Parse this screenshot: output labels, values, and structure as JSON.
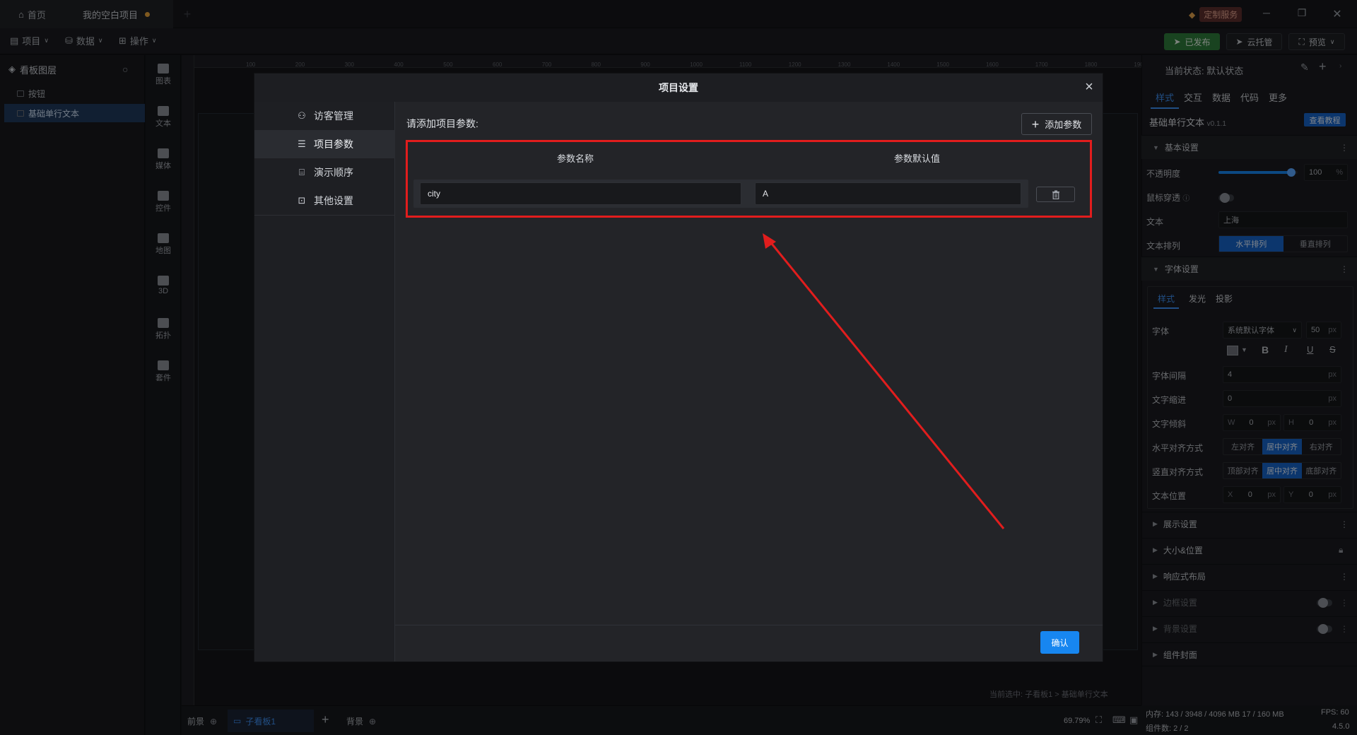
{
  "titlebar": {
    "home_tab": "首页",
    "project_tab": "我的空白项目",
    "custom_service": "定制服务"
  },
  "menubar": {
    "project": "项目",
    "data": "数据",
    "operate": "操作",
    "published": "已发布",
    "cloud_host": "云托管",
    "preview": "预览"
  },
  "layers": {
    "title": "看板图层",
    "items": [
      "按钮",
      "基础单行文本"
    ]
  },
  "components": [
    "图表",
    "文本",
    "媒体",
    "控件",
    "地图",
    "3D",
    "拓扑",
    "套件"
  ],
  "ruler_ticks": [
    "100",
    "200",
    "300",
    "400",
    "500",
    "600",
    "700",
    "800",
    "900",
    "1000",
    "1100",
    "1200",
    "1300",
    "1400",
    "1500",
    "1600",
    "1700",
    "1800",
    "1900"
  ],
  "canvas": {
    "status_caption": "当前选中: 子看板1 > 基础单行文本"
  },
  "bottombar": {
    "foreground": "前景",
    "sub_board": "子看板1",
    "background": "背景",
    "zoom": "69.79%"
  },
  "bottom_status": {
    "memory": "内存: 143 / 3948 / 4096 MB  17 / 160 MB",
    "fps": "FPS: 60",
    "component_count": "组件数: 2 / 2",
    "version": "4.5.0"
  },
  "right_panel": {
    "current_state": "当前状态: 默认状态",
    "tabs": [
      "样式",
      "交互",
      "数据",
      "代码",
      "更多"
    ],
    "component_name": "基础单行文本",
    "component_version": "v0.1.1",
    "tutorial_btn": "查看教程",
    "basic_settings": "基本设置",
    "opacity_label": "不透明度",
    "opacity_value": "100",
    "opacity_unit": "%",
    "opacity_level": 0.92,
    "mouse_through_label": "鼠标穿透",
    "text_label": "文本",
    "text_value": "上海",
    "text_arrange_label": "文本排列",
    "arrange_h": "水平排列",
    "arrange_v": "垂直排列",
    "font_settings": "字体设置",
    "font_tabs": [
      "样式",
      "发光",
      "投影"
    ],
    "font_label": "字体",
    "font_value": "系统默认字体",
    "font_size": "50",
    "px": "px",
    "letter_spacing_label": "字体间隔",
    "letter_spacing_value": "4",
    "indent_label": "文字缩进",
    "indent_value": "0",
    "skew_label": "文字倾斜",
    "skew_w_label": "W",
    "skew_w": "0",
    "skew_h_label": "H",
    "skew_h": "0",
    "h_align_label": "水平对齐方式",
    "h_align_options": [
      "左对齐",
      "居中对齐",
      "右对齐"
    ],
    "v_align_label": "竖直对齐方式",
    "v_align_options": [
      "顶部对齐",
      "居中对齐",
      "底部对齐"
    ],
    "text_pos_label": "文本位置",
    "pos_x_label": "X",
    "pos_x": "0",
    "pos_y_label": "Y",
    "pos_y": "0",
    "sections": [
      "展示设置",
      "大小&位置",
      "响应式布局",
      "边框设置",
      "背景设置",
      "组件封面"
    ]
  },
  "modal": {
    "title": "项目设置",
    "nav": [
      "访客管理",
      "项目参数",
      "演示顺序",
      "其他设置"
    ],
    "prompt": "请添加项目参数:",
    "add_param": "添加参数",
    "col_name": "参数名称",
    "col_default": "参数默认值",
    "rows": [
      {
        "name": "city",
        "default": "A"
      }
    ],
    "confirm": "确认"
  },
  "colors": {
    "accent": "#1786f0",
    "highlight": "#e11d1d",
    "published": "#2f7a3b"
  }
}
